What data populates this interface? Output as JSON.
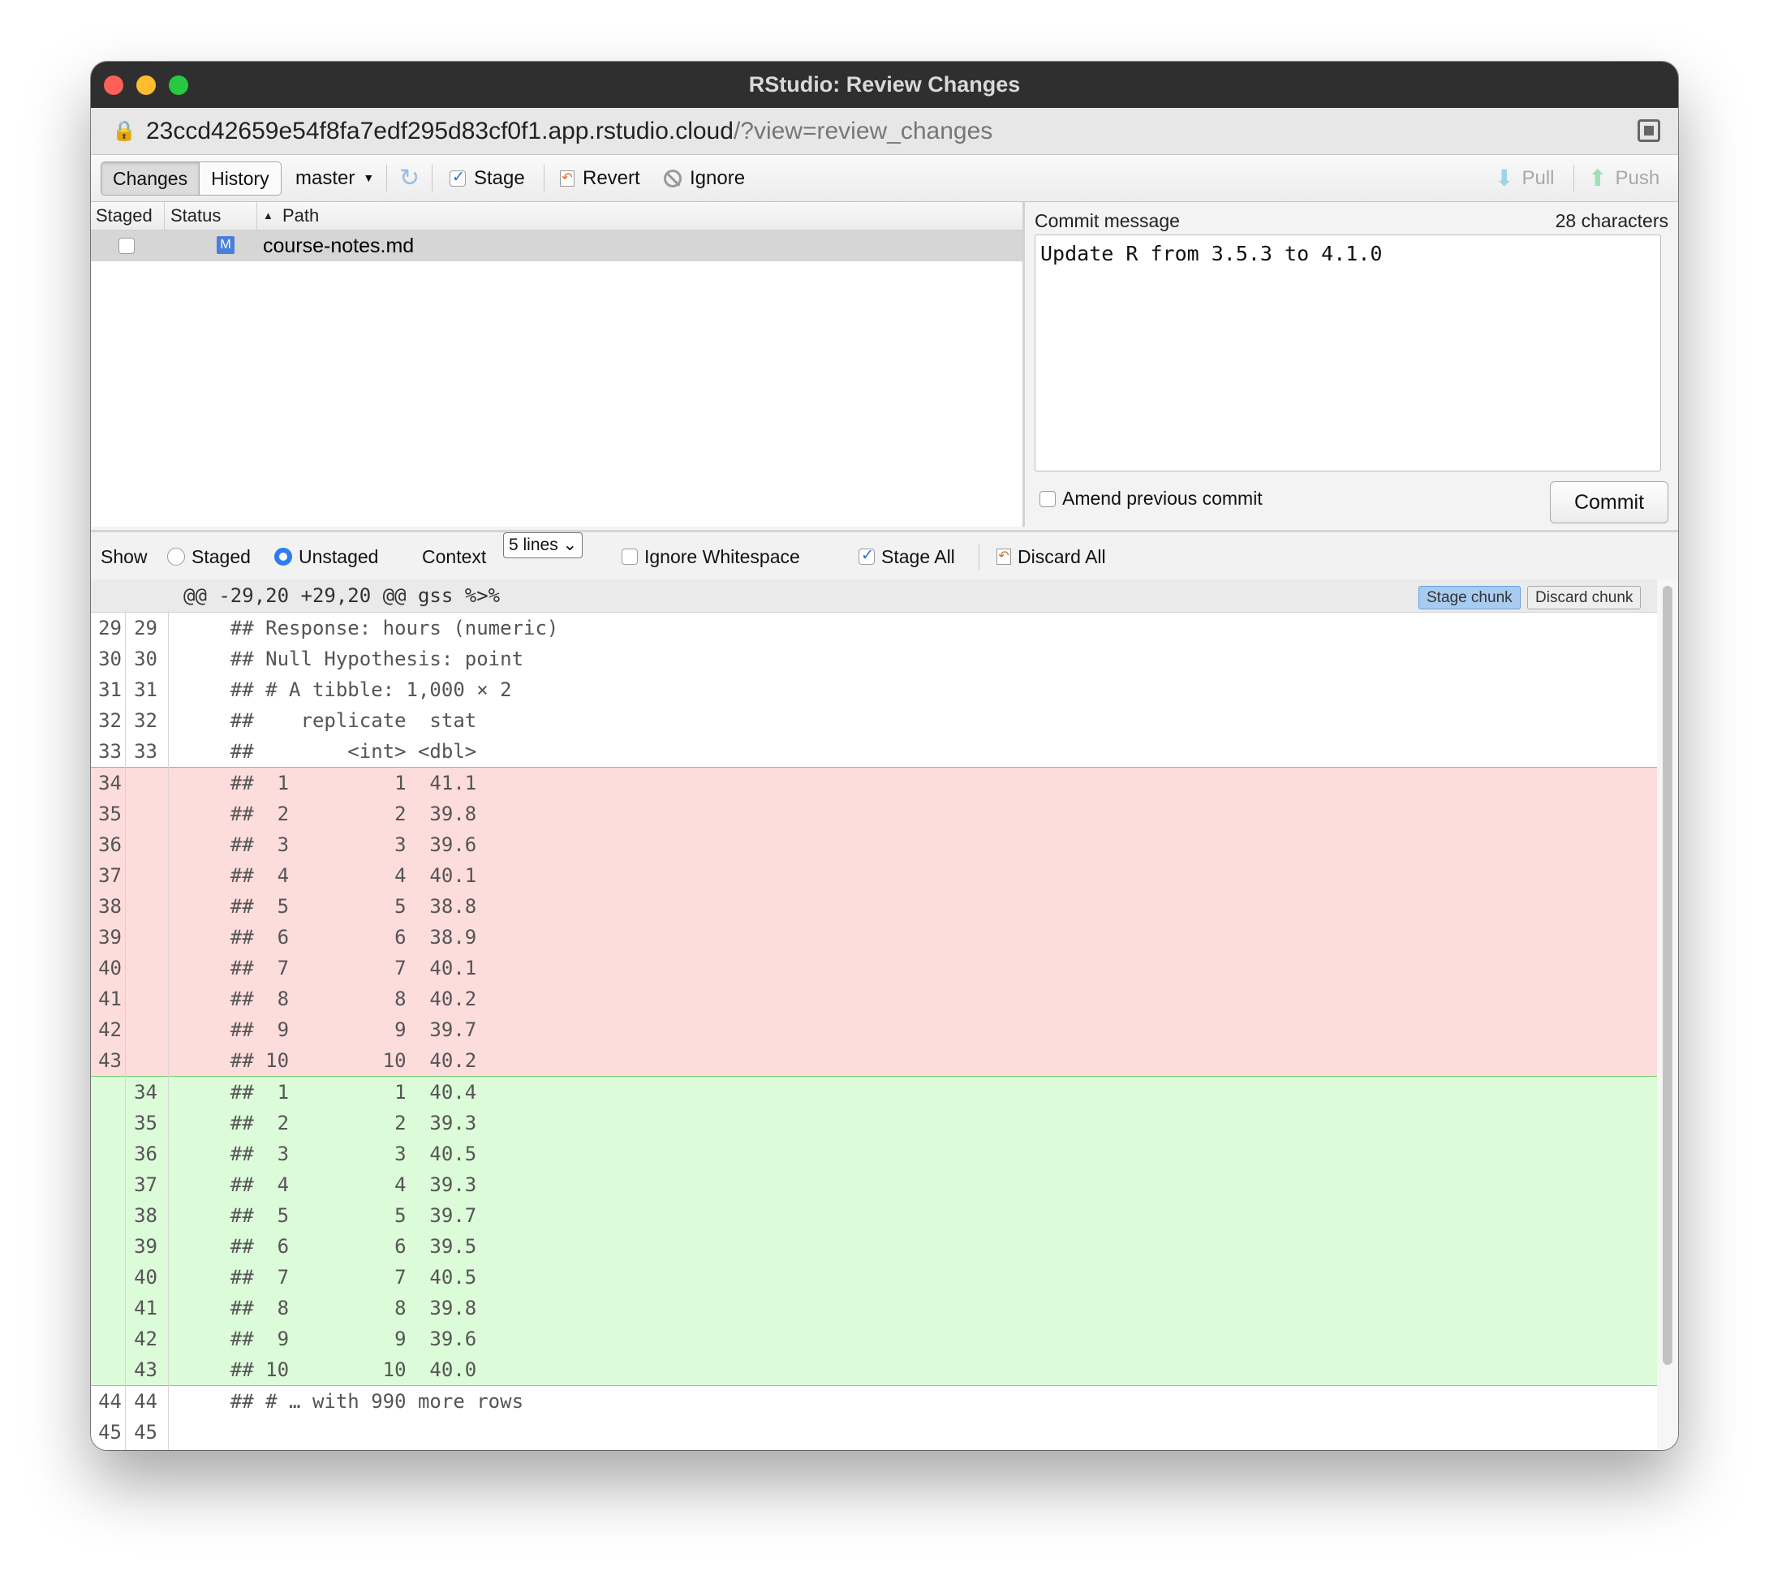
{
  "window": {
    "title": "RStudio: Review Changes",
    "traffic_colors": [
      "#ff5f57",
      "#febc2e",
      "#28c840"
    ]
  },
  "address": {
    "url_main": "23ccd42659e54f8fa7edf295d83cf0f1.app.rstudio.cloud",
    "url_rest": "/?view=review_changes"
  },
  "toolbar": {
    "tab_changes": "Changes",
    "tab_history": "History",
    "branch": "master",
    "stage": "Stage",
    "revert": "Revert",
    "ignore": "Ignore",
    "pull": "Pull",
    "push": "Push"
  },
  "files": {
    "headers": {
      "staged": "Staged",
      "status": "Status",
      "path": "Path"
    },
    "rows": [
      {
        "status": "M",
        "path": "course-notes.md"
      }
    ]
  },
  "commit": {
    "label": "Commit message",
    "char_count": "28 characters",
    "message": "Update R from 3.5.3 to 4.1.0",
    "amend_label": "Amend previous commit",
    "button": "Commit"
  },
  "showbar": {
    "show": "Show",
    "staged": "Staged",
    "unstaged": "Unstaged",
    "context": "Context",
    "context_value": "5 lines",
    "ignore_ws": "Ignore Whitespace",
    "stage_all": "Stage All",
    "discard_all": "Discard All"
  },
  "diff": {
    "chunk_header": "@@ -29,20 +29,20 @@ gss %>%",
    "stage_chunk": "Stage chunk",
    "discard_chunk": "Discard chunk",
    "lines": [
      {
        "type": "ctx",
        "old": "29",
        "new": "29",
        "text": "    ## Response: hours (numeric)"
      },
      {
        "type": "ctx",
        "old": "30",
        "new": "30",
        "text": "    ## Null Hypothesis: point"
      },
      {
        "type": "ctx",
        "old": "31",
        "new": "31",
        "text": "    ## # A tibble: 1,000 × 2"
      },
      {
        "type": "ctx",
        "old": "32",
        "new": "32",
        "text": "    ##    replicate  stat"
      },
      {
        "type": "ctx",
        "old": "33",
        "new": "33",
        "text": "    ##        <int> <dbl>"
      },
      {
        "type": "del",
        "old": "34",
        "new": "",
        "text": "    ##  1         1  41.1"
      },
      {
        "type": "del",
        "old": "35",
        "new": "",
        "text": "    ##  2         2  39.8"
      },
      {
        "type": "del",
        "old": "36",
        "new": "",
        "text": "    ##  3         3  39.6"
      },
      {
        "type": "del",
        "old": "37",
        "new": "",
        "text": "    ##  4         4  40.1"
      },
      {
        "type": "del",
        "old": "38",
        "new": "",
        "text": "    ##  5         5  38.8"
      },
      {
        "type": "del",
        "old": "39",
        "new": "",
        "text": "    ##  6         6  38.9"
      },
      {
        "type": "del",
        "old": "40",
        "new": "",
        "text": "    ##  7         7  40.1"
      },
      {
        "type": "del",
        "old": "41",
        "new": "",
        "text": "    ##  8         8  40.2"
      },
      {
        "type": "del",
        "old": "42",
        "new": "",
        "text": "    ##  9         9  39.7"
      },
      {
        "type": "del",
        "old": "43",
        "new": "",
        "text": "    ## 10        10  40.2"
      },
      {
        "type": "add",
        "old": "",
        "new": "34",
        "text": "    ##  1         1  40.4"
      },
      {
        "type": "add",
        "old": "",
        "new": "35",
        "text": "    ##  2         2  39.3"
      },
      {
        "type": "add",
        "old": "",
        "new": "36",
        "text": "    ##  3         3  40.5"
      },
      {
        "type": "add",
        "old": "",
        "new": "37",
        "text": "    ##  4         4  39.3"
      },
      {
        "type": "add",
        "old": "",
        "new": "38",
        "text": "    ##  5         5  39.7"
      },
      {
        "type": "add",
        "old": "",
        "new": "39",
        "text": "    ##  6         6  39.5"
      },
      {
        "type": "add",
        "old": "",
        "new": "40",
        "text": "    ##  7         7  40.5"
      },
      {
        "type": "add",
        "old": "",
        "new": "41",
        "text": "    ##  8         8  39.8"
      },
      {
        "type": "add",
        "old": "",
        "new": "42",
        "text": "    ##  9         9  39.6"
      },
      {
        "type": "add",
        "old": "",
        "new": "43",
        "text": "    ## 10        10  40.0"
      },
      {
        "type": "ctx",
        "old": "44",
        "new": "44",
        "text": "    ## # … with 990 more rows"
      },
      {
        "type": "ctx",
        "old": "45",
        "new": "45",
        "text": ""
      }
    ]
  }
}
